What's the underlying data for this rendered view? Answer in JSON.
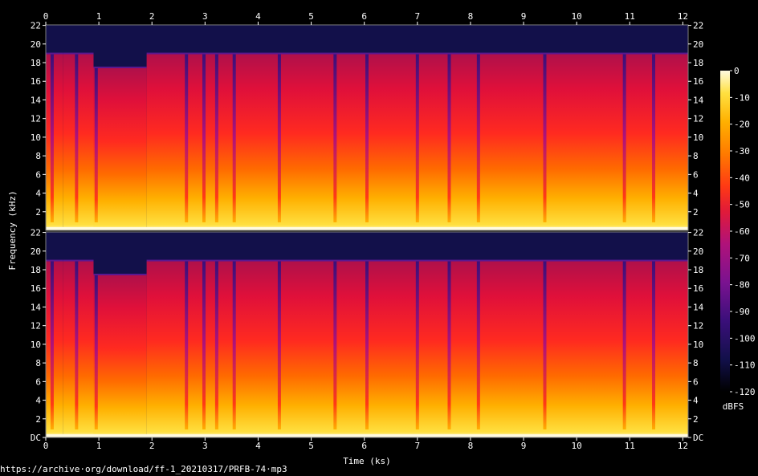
{
  "source_url": "https://archive·org/download/ff-1_20210317/PRFB-74·mp3",
  "chart_data": {
    "type": "heatmap",
    "subtype": "spectrogram",
    "channels": 2,
    "xlabel": "Time (ks)",
    "ylabel": "Frequency (kHz)",
    "xlim": [
      0,
      12.1
    ],
    "ylim": [
      0,
      22.05
    ],
    "x_ticks": [
      "0",
      "1",
      "2",
      "3",
      "4",
      "5",
      "6",
      "7",
      "8",
      "9",
      "10",
      "11",
      "12"
    ],
    "y_ticks": [
      "DC",
      "2",
      "4",
      "6",
      "8",
      "10",
      "12",
      "14",
      "16",
      "18",
      "20",
      "22"
    ],
    "colorbar": {
      "label": "dBFS",
      "range": [
        -120,
        0
      ],
      "ticks": [
        "0",
        "-10",
        "-20",
        "-30",
        "-40",
        "-50",
        "-60",
        "-70",
        "-80",
        "-90",
        "-100",
        "-110",
        "-120"
      ],
      "colors": [
        "#000000",
        "#12104a",
        "#3a0f7a",
        "#7a1290",
        "#b0127a",
        "#e01a3a",
        "#ff3a14",
        "#ff7a00",
        "#ffb000",
        "#ffe040",
        "#fffbe0"
      ]
    },
    "content_cutoff_khz": 18.9,
    "segments": [
      {
        "start": 0.0,
        "end": 0.33,
        "cutoff_khz": 18.9
      },
      {
        "start": 0.33,
        "end": 0.9,
        "cutoff_khz": 18.9
      },
      {
        "start": 0.9,
        "end": 1.9,
        "cutoff_khz": 17.4
      },
      {
        "start": 1.9,
        "end": 12.1,
        "cutoff_khz": 18.9
      }
    ],
    "quiet_gaps_ks": [
      0.12,
      0.58,
      0.95,
      2.65,
      2.98,
      3.22,
      3.55,
      4.4,
      5.45,
      6.05,
      7.0,
      7.6,
      8.15,
      9.4,
      10.9,
      11.45
    ]
  }
}
